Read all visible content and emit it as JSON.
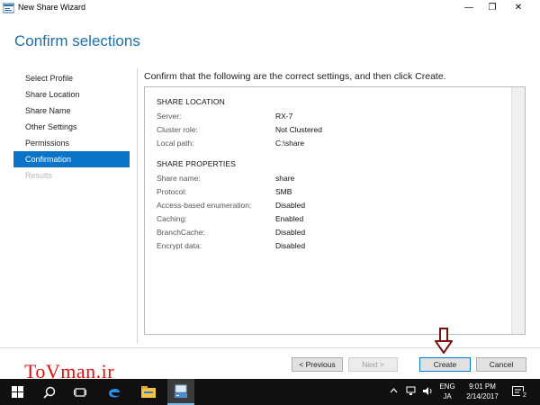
{
  "window": {
    "title": "New Share Wizard",
    "minimize_glyph": "—",
    "maximize_glyph": "❐",
    "close_glyph": "✕"
  },
  "page": {
    "heading": "Confirm selections",
    "instruction": "Confirm that the following are the correct settings, and then click Create."
  },
  "nav": {
    "items": [
      {
        "label": "Select Profile",
        "state": "normal"
      },
      {
        "label": "Share Location",
        "state": "normal"
      },
      {
        "label": "Share Name",
        "state": "normal"
      },
      {
        "label": "Other Settings",
        "state": "normal"
      },
      {
        "label": "Permissions",
        "state": "normal"
      },
      {
        "label": "Confirmation",
        "state": "active"
      },
      {
        "label": "Results",
        "state": "disabled"
      }
    ]
  },
  "summary": {
    "location": {
      "title": "SHARE LOCATION",
      "rows": [
        {
          "key": "Server:",
          "value": "RX-7"
        },
        {
          "key": "Cluster role:",
          "value": "Not Clustered"
        },
        {
          "key": "Local path:",
          "value": "C:\\share"
        }
      ]
    },
    "properties": {
      "title": "SHARE PROPERTIES",
      "rows": [
        {
          "key": "Share name:",
          "value": "share"
        },
        {
          "key": "Protocol:",
          "value": "SMB"
        },
        {
          "key": "Access-based enumeration:",
          "value": "Disabled"
        },
        {
          "key": "Caching:",
          "value": "Enabled"
        },
        {
          "key": "BranchCache:",
          "value": "Disabled"
        },
        {
          "key": "Encrypt data:",
          "value": "Disabled"
        }
      ]
    }
  },
  "buttons": {
    "previous": "< Previous",
    "next": "Next >",
    "create": "Create",
    "cancel": "Cancel"
  },
  "watermark": "ToVman.ir",
  "taskbar": {
    "icons": [
      "windows-start-icon",
      "search-icon",
      "task-view-icon",
      "edge-icon",
      "file-explorer-icon",
      "server-manager-icon"
    ],
    "language_top": "ENG",
    "language_bottom": "JA",
    "time": "9:01 PM",
    "date": "2/14/2017",
    "notification_count": "2"
  },
  "colors": {
    "accent": "#0b74c7",
    "heading": "#1e6fa8",
    "watermark": "#e01010",
    "arrow": "#7a1010",
    "taskbar": "#101010"
  }
}
